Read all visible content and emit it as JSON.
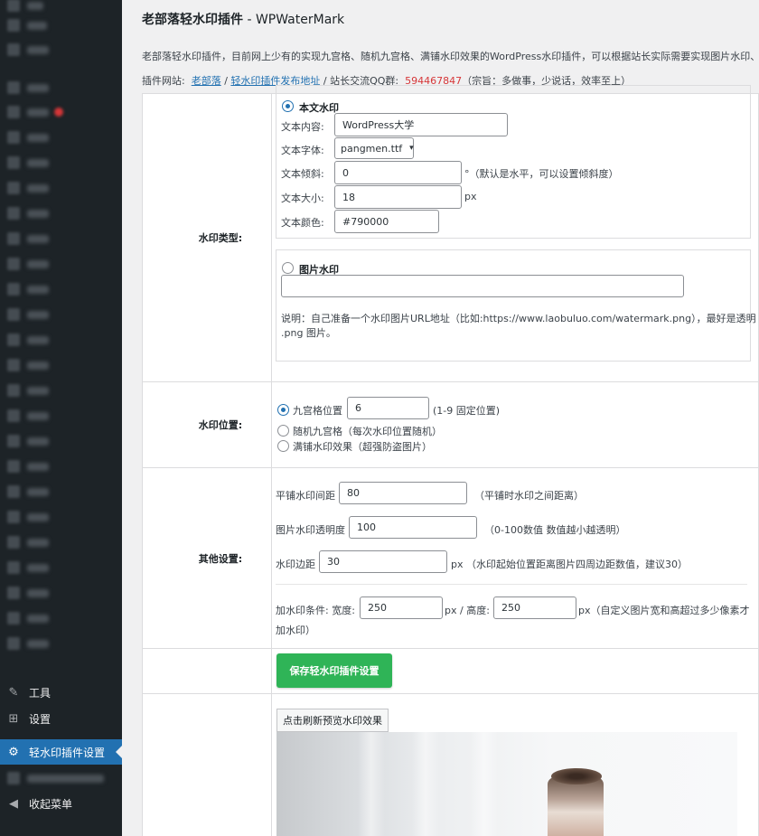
{
  "sidebar": {
    "items": [
      {
        "label": "工具",
        "icon": "wrench-icon",
        "glyph": "🔧"
      },
      {
        "label": "设置",
        "icon": "settings-icon",
        "glyph": "⊞"
      },
      {
        "label": "轻水印插件设置",
        "icon": "gear-icon",
        "glyph": "⚙"
      },
      {
        "label": "收起菜单",
        "icon": "collapse-icon",
        "glyph": "◀"
      }
    ]
  },
  "header": {
    "title_cn": "老部落轻水印插件",
    "title_en": " - WPWaterMark"
  },
  "intro": "老部落轻水印插件，目前网上少有的实现九宫格、随机九宫格、满铺水印效果的WordPress水印插件，可以根据站长实际需要实现图片水印、采",
  "site_line": {
    "prefix": "插件网站:",
    "link1": "老部落",
    "sep": " / ",
    "link2": "轻水印插件发布地址",
    "middle": " / 站长交流QQ群: ",
    "qq": "594467847",
    "suffix": "（宗旨：多做事，少说话，效率至上）"
  },
  "watermark_type": {
    "label": "水印类型:",
    "text_option": "本文水印",
    "text_content_label": "文本内容:",
    "text_content_value": "WordPress大学",
    "font_label": "文本字体:",
    "font_value": "pangmen.ttf",
    "tilt_label": "文本倾斜:",
    "tilt_value": "0",
    "tilt_hint": "°（默认是水平，可以设置倾斜度）",
    "size_label": "文本大小:",
    "size_value": "18",
    "size_unit": "px",
    "color_label": "文本颜色:",
    "color_value": "#790000",
    "image_option": "图片水印",
    "image_url_value": "",
    "image_note_1": "说明：自己准备一个水印图片URL地址（比如:https://www.laobuluo.com/watermark.png），最好是透明",
    "image_note_2": ".png 图片。"
  },
  "watermark_position": {
    "label": "水印位置:",
    "opt1": "九宫格位置",
    "opt1_value": "6",
    "opt1_hint": "(1-9 固定位置)",
    "opt2": "随机九宫格（每次水印位置随机）",
    "opt3": "满铺水印效果（超强防盗图片）"
  },
  "other_settings": {
    "label": "其他设置:",
    "spacing_label": "平铺水印间距",
    "spacing_value": "80",
    "spacing_hint": "（平铺时水印之间距离）",
    "opacity_label": "图片水印透明度",
    "opacity_value": "100",
    "opacity_hint": "（0-100数值 数值越小越透明）",
    "margin_label": "水印边距",
    "margin_value": "30",
    "margin_hint": "px （水印起始位置距离图片四周边距数值，建议30）",
    "cond_label": "加水印条件: 宽度:",
    "cond_width": "250",
    "cond_mid": "px / 高度:",
    "cond_height": "250",
    "cond_hint_1": "px（自定义图片宽和高超过多少像素才",
    "cond_hint_2": "加水印）"
  },
  "save_button": "保存轻水印插件设置",
  "preview_button": "点击刷新预览水印效果",
  "colors": {
    "sidebar_bg": "#1d2327",
    "active_menu": "#2271b1",
    "save_button": "#2fb457",
    "qq_link": "#d63638"
  }
}
